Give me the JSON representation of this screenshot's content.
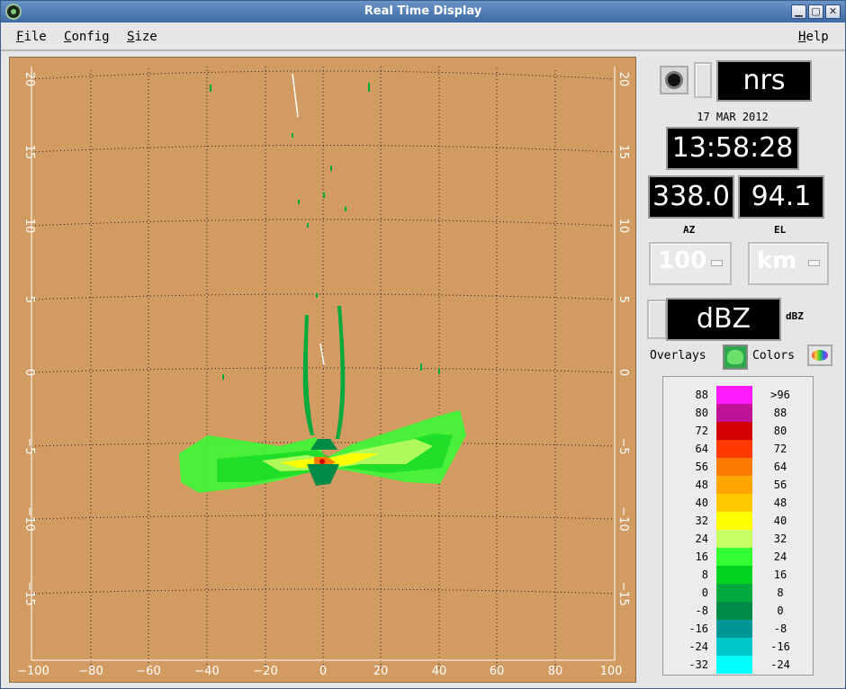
{
  "window": {
    "title": "Real Time Display",
    "minimize_label": "▁",
    "maximize_label": "▢",
    "close_label": "✕"
  },
  "menu": {
    "file": "File",
    "config": "Config",
    "size": "Size",
    "help": "Help"
  },
  "plot": {
    "x_ticks": [
      "−100",
      "−80",
      "−60",
      "−40",
      "−20",
      "0",
      "20",
      "40",
      "60",
      "80",
      "100"
    ],
    "y_ticks": [
      "20",
      "15",
      "10",
      "5",
      "0",
      "−5",
      "−10",
      "−15"
    ],
    "background_color": "#d19b62"
  },
  "status": {
    "radar_name": "nrs",
    "date": "17 MAR 2012",
    "time": "13:58:28",
    "az_value": "338.0",
    "el_value": "94.1",
    "az_label": "AZ",
    "el_label": "EL",
    "range_value": "100",
    "unit_value": "km",
    "field_value": "dBZ",
    "field_unit": "dBZ",
    "overlays_label": "Overlays",
    "colors_label": "Colors"
  },
  "colorbar": [
    {
      "lo": "88",
      "hi": ">96",
      "color": "#ff19ff"
    },
    {
      "lo": "80",
      "hi": "88",
      "color": "#c01296"
    },
    {
      "lo": "72",
      "hi": "80",
      "color": "#d40000"
    },
    {
      "lo": "64",
      "hi": "72",
      "color": "#ff3a00"
    },
    {
      "lo": "56",
      "hi": "64",
      "color": "#ff7a00"
    },
    {
      "lo": "48",
      "hi": "56",
      "color": "#ffa500"
    },
    {
      "lo": "40",
      "hi": "48",
      "color": "#ffc800"
    },
    {
      "lo": "32",
      "hi": "40",
      "color": "#ffff00"
    },
    {
      "lo": "24",
      "hi": "32",
      "color": "#c8ff64"
    },
    {
      "lo": "16",
      "hi": "24",
      "color": "#33ff33"
    },
    {
      "lo": "8",
      "hi": "16",
      "color": "#00d21e"
    },
    {
      "lo": "0",
      "hi": "8",
      "color": "#00aa3c"
    },
    {
      "lo": "-8",
      "hi": "0",
      "color": "#008c46"
    },
    {
      "lo": "-16",
      "hi": "-8",
      "color": "#009696"
    },
    {
      "lo": "-24",
      "hi": "-16",
      "color": "#00c8c8"
    },
    {
      "lo": "-32",
      "hi": "-24",
      "color": "#00ffff"
    }
  ]
}
